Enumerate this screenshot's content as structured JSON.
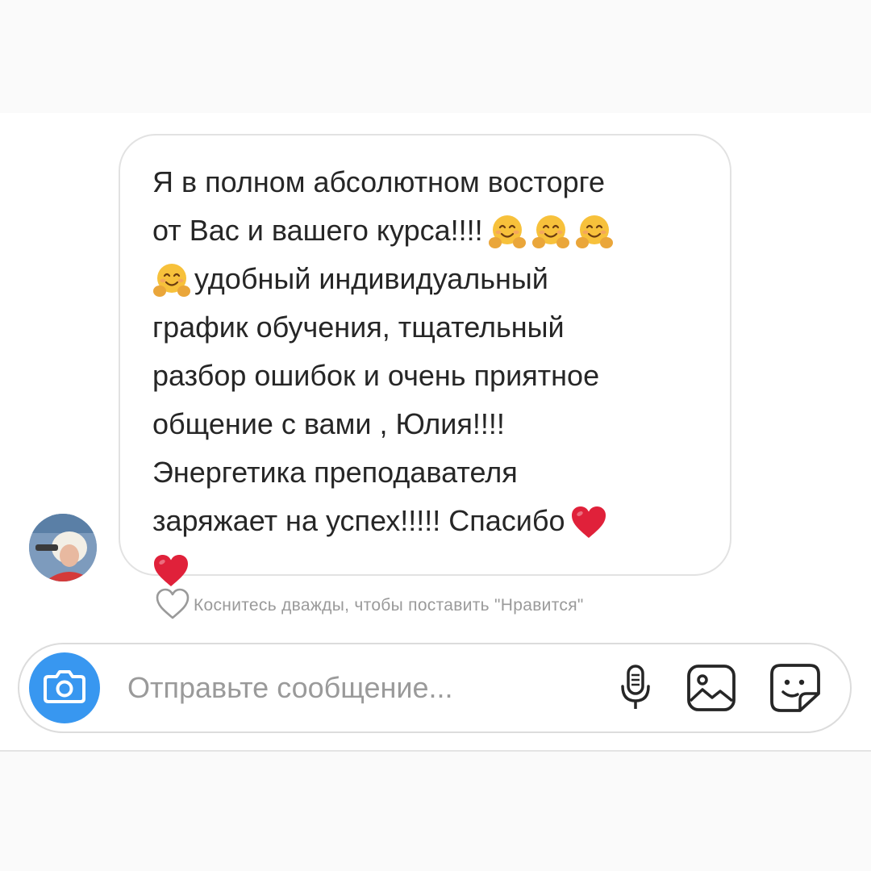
{
  "message": {
    "lines": [
      {
        "text": "Я в полном абсолютном восторге",
        "emojis_before": [],
        "emojis_after": []
      },
      {
        "text": "от Вас и вашего курса!!!!",
        "emojis_before": [],
        "emojis_after": [
          "hugging-face",
          "hugging-face",
          "hugging-face"
        ]
      },
      {
        "text": "удобный индивидуальный",
        "emojis_before": [
          "hugging-face"
        ],
        "emojis_after": []
      },
      {
        "text": "график обучения, тщательный",
        "emojis_before": [],
        "emojis_after": []
      },
      {
        "text": "разбор ошибок и очень приятное",
        "emojis_before": [],
        "emojis_after": []
      },
      {
        "text": "общение с вами , Юлия!!!!",
        "emojis_before": [],
        "emojis_after": []
      },
      {
        "text": "Энергетика преподавателя",
        "emojis_before": [],
        "emojis_after": []
      },
      {
        "text": "заряжает на успех!!!!! Спасибо",
        "emojis_before": [],
        "emojis_after": [
          "red-heart"
        ]
      },
      {
        "text": "",
        "emojis_before": [
          "red-heart"
        ],
        "emojis_after": []
      }
    ]
  },
  "like_hint": {
    "icon": "heart-outline-icon",
    "text": "Коснитесь дважды, чтобы поставить \"Нравится\""
  },
  "composer": {
    "placeholder": "Отправьте сообщение...",
    "value": "",
    "camera_icon": "camera-icon",
    "mic_icon": "microphone-icon",
    "gallery_icon": "gallery-icon",
    "sticker_icon": "sticker-icon"
  },
  "colors": {
    "accent": "#3897f0",
    "heart": "#e0213a",
    "emoji_face": "#f7c13b",
    "text": "#262626",
    "muted": "#9a9a9a"
  }
}
